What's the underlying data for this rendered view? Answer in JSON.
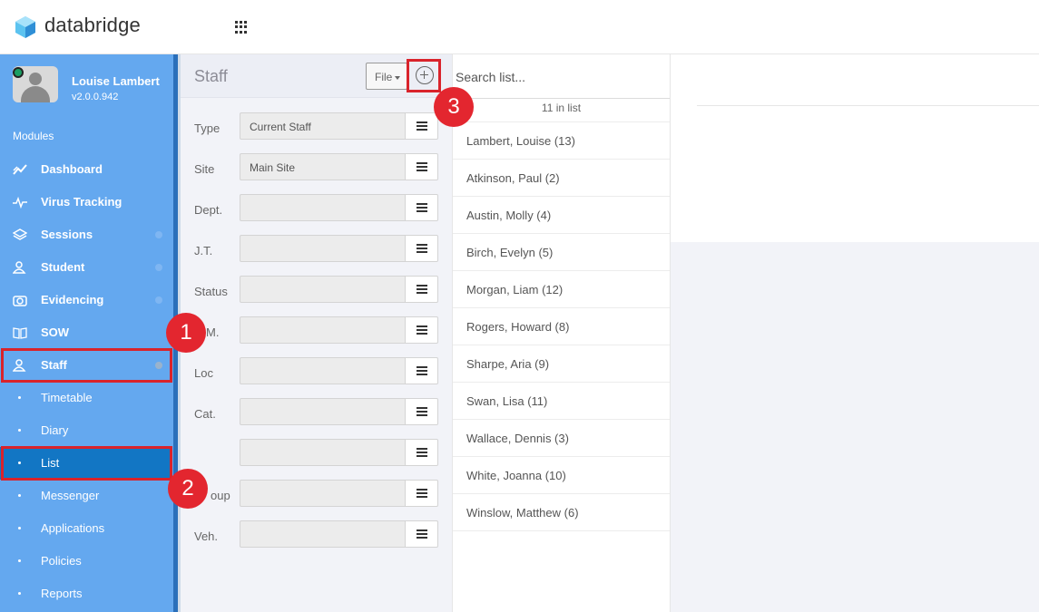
{
  "header": {
    "brand": "databridge",
    "brand_color": "#3ba3e0"
  },
  "user": {
    "name": "Louise Lambert",
    "version": "v2.0.0.942"
  },
  "sidebar": {
    "modules_title": "Modules",
    "items": [
      {
        "label": "Dashboard",
        "icon": "chart-line-icon"
      },
      {
        "label": "Virus Tracking",
        "icon": "pulse-icon"
      },
      {
        "label": "Sessions",
        "icon": "layers-icon"
      },
      {
        "label": "Student",
        "icon": "users-icon"
      },
      {
        "label": "Evidencing",
        "icon": "camera-icon"
      },
      {
        "label": "SOW",
        "icon": "book-icon"
      },
      {
        "label": "Staff",
        "icon": "users-icon"
      }
    ],
    "sub_items": [
      {
        "label": "Timetable"
      },
      {
        "label": "Diary"
      },
      {
        "label": "List"
      },
      {
        "label": "Messenger"
      },
      {
        "label": "Applications"
      },
      {
        "label": "Policies"
      },
      {
        "label": "Reports"
      }
    ],
    "accent": "#64a8ef",
    "selected_color": "#1276c4"
  },
  "filter_panel": {
    "title": "Staff",
    "file_label": "File",
    "filters": [
      {
        "label": "Type",
        "value": "Current Staff"
      },
      {
        "label": "Site",
        "value": "Main Site"
      },
      {
        "label": "Dept.",
        "value": ""
      },
      {
        "label": "J.T.",
        "value": ""
      },
      {
        "label": "Status",
        "value": ""
      },
      {
        "label": "M.",
        "value": ""
      },
      {
        "label": "Loc",
        "value": ""
      },
      {
        "label": "Cat.",
        "value": ""
      },
      {
        "label": "",
        "value": ""
      },
      {
        "label": "oup",
        "value": ""
      },
      {
        "label": "Veh.",
        "value": ""
      }
    ]
  },
  "list": {
    "search_placeholder": "Search list...",
    "count": "11 in list",
    "items": [
      "Lambert, Louise (13)",
      "Atkinson, Paul (2)",
      "Austin, Molly (4)",
      "Birch, Evelyn (5)",
      "Morgan, Liam (12)",
      "Rogers, Howard (8)",
      "Sharpe, Aria (9)",
      "Swan, Lisa (11)",
      "Wallace, Dennis (3)",
      "White, Joanna (10)",
      "Winslow, Matthew (6)"
    ]
  },
  "annotations": [
    {
      "number": "1"
    },
    {
      "number": "2"
    },
    {
      "number": "3"
    }
  ],
  "annotation_color": "#e3262f"
}
